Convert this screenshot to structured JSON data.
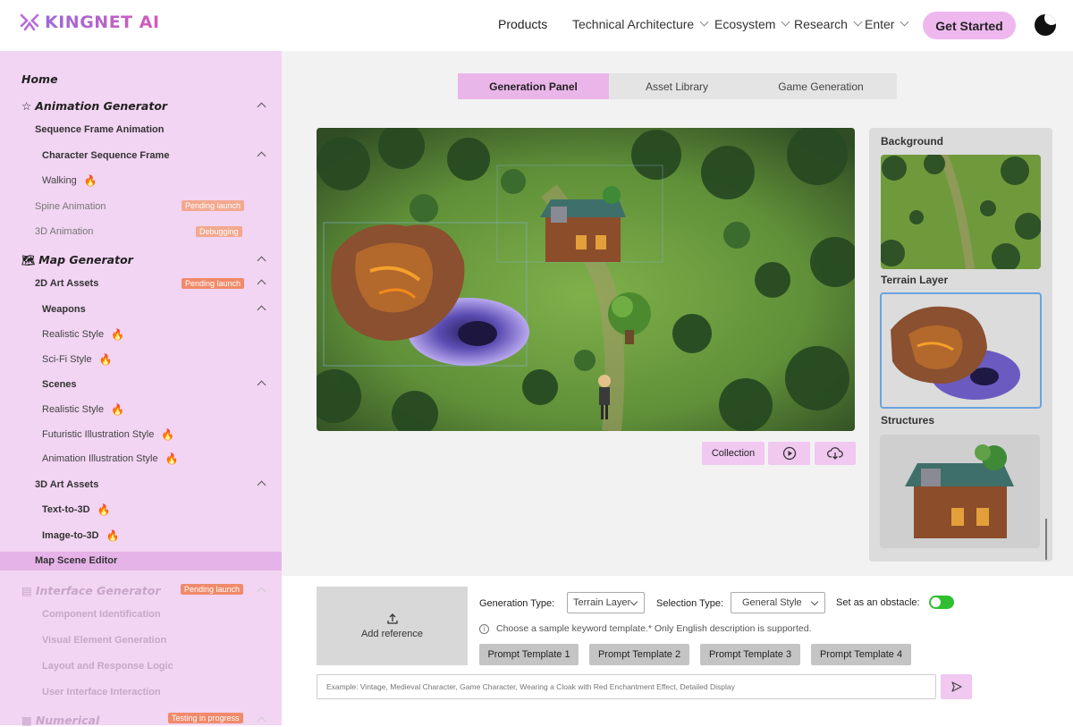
{
  "brand": {
    "name": "KINGNET AI"
  },
  "nav": {
    "items": [
      {
        "label": "Products"
      },
      {
        "label": "Technical Architecture"
      },
      {
        "label": "Ecosystem"
      },
      {
        "label": "Research"
      },
      {
        "label": "Enter"
      }
    ],
    "cta": "Get Started"
  },
  "sidebar": {
    "home": "Home",
    "animation_generator": "Animation Generator",
    "sequence_frame_animation": "Sequence Frame Animation",
    "character_sequence_frame": "Character Sequence Frame",
    "walking": "Walking",
    "spine_animation": "Spine Animation",
    "spine_badge": "Pending launch",
    "animation_3d": "3D Animation",
    "animation_3d_badge": "Debugging",
    "map_generator": "Map Generator",
    "art_assets_2d": "2D Art Assets",
    "art_assets_2d_badge": "Pending launch",
    "weapons": "Weapons",
    "weapons_realistic": "Realistic Style",
    "weapons_scifi": "Sci-Fi Style",
    "scenes": "Scenes",
    "scenes_realistic": "Realistic Style",
    "scenes_futuristic": "Futuristic Illustration Style",
    "scenes_animation": "Animation Illustration Style",
    "art_assets_3d": "3D Art Assets",
    "text_to_3d": "Text-to-3D",
    "image_to_3d": "Image-to-3D",
    "map_scene_editor": "Map Scene Editor",
    "interface_generator": "Interface Generator",
    "interface_badge": "Pending launch",
    "component_identification": "Component Identification",
    "visual_element_generation": "Visual Element Generation",
    "layout_response_logic": "Layout and Response Logic",
    "ui_interaction": "User Interface Interaction",
    "numerical": "Numerical",
    "numerical_badge": "Testing in progress"
  },
  "tabs": [
    {
      "label": "Generation Panel",
      "active": true
    },
    {
      "label": "Asset Library",
      "active": false
    },
    {
      "label": "Game Generation",
      "active": false
    }
  ],
  "canvas_actions": {
    "collection": "Collection"
  },
  "layers": {
    "background": "Background",
    "terrain": "Terrain Layer",
    "structures": "Structures"
  },
  "generator": {
    "add_reference": "Add reference",
    "generation_type_label": "Generation Type:",
    "generation_type_value": "Terrain Layer",
    "selection_type_label": "Selection Type:",
    "selection_type_value": "General Style",
    "obstacle_label": "Set as an obstacle:",
    "obstacle_on": true,
    "hint": "Choose a sample keyword template.* Only English description is supported.",
    "templates": [
      "Prompt Template 1",
      "Prompt Template 2",
      "Prompt Template 3",
      "Prompt Template 4"
    ],
    "prompt_placeholder": "Example: Vintage, Medieval Character, Game Character, Wearing a Cloak with Red Enchantment Effect, Detailed Display"
  },
  "colors": {
    "accent": "#eab6ea",
    "sidebar_bg": "#f2d4f3",
    "active_row": "#e6b3e8",
    "toggle": "#2fbf2f"
  }
}
